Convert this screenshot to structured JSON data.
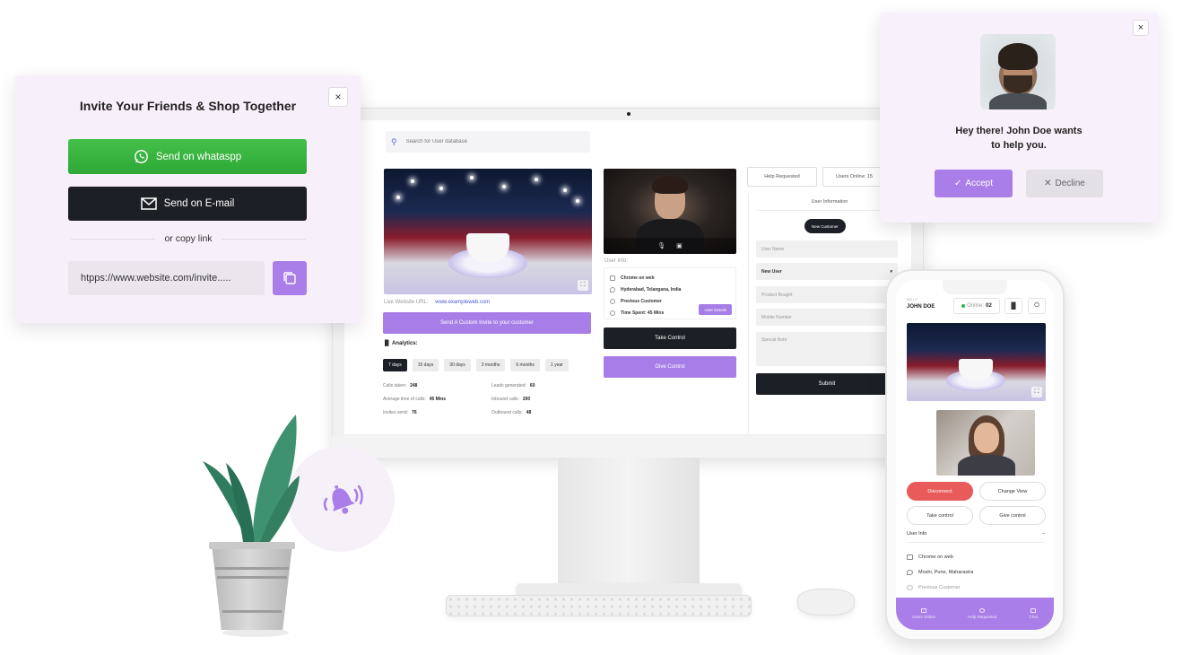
{
  "invite_panel": {
    "title": "Invite Your Friends & Shop Together",
    "close_label": "×",
    "whatsapp_label": "Send on whataspp",
    "email_label": "Send on E-mail",
    "divider_text": "or copy link",
    "link_value": "htpps://www.website.com/invite....."
  },
  "help_popup": {
    "close_label": "×",
    "message_line1": "Hey there! John Doe wants",
    "message_line2": "to help you.",
    "accept_label": "Accept",
    "decline_label": "Decline"
  },
  "desktop": {
    "search_placeholder": "Search for User database",
    "live_url_label": "Live Website URL:",
    "live_url_value": "www.exampleweb.com",
    "send_invite_label": "Send A Custom Invite to your customer",
    "analytics_title": "Analytics:",
    "ranges": [
      "7 days",
      "15 days",
      "30 days",
      "3 months",
      "6 months",
      "1 year"
    ],
    "active_range": "7 days",
    "stats": [
      {
        "label": "Calls taken:",
        "value": "248"
      },
      {
        "label": "Average time of calls:",
        "value": "45 Mins"
      },
      {
        "label": "Invites send:",
        "value": "76"
      },
      {
        "label": "Leads generated:",
        "value": "60"
      },
      {
        "label": "Inbound calls:",
        "value": "200"
      },
      {
        "label": "Outbound calls:",
        "value": "48"
      }
    ],
    "user_info_label": "User Info:",
    "user_info": {
      "browser": "Chrome on web",
      "location": "Hyderabad, Telangana, India",
      "status": "Previous Customer",
      "time_spent": "Time Spent: 45 Mins"
    },
    "user_details_label": "User Details",
    "take_control_label": "Take Control",
    "give_control_label": "Give Control",
    "help_requested_label": "Help Requested",
    "users_online_label": "Users Online: 15",
    "form_title": "User Information",
    "new_customer_label": "New Customer",
    "user_name_placeholder": "User Name",
    "new_user_value": "New User",
    "product_bought_placeholder": "Product Bought",
    "mobile_number_placeholder": "Mobile Number",
    "special_note_placeholder": "Special Note",
    "submit_label": "Submit"
  },
  "phone": {
    "hello_label": "HELLO",
    "user_name": "JOHN DOE",
    "online_label": "Online:",
    "online_count": "02",
    "disconnect_label": "Disconnect",
    "change_view_label": "Change View",
    "take_control_label": "Take control",
    "give_control_label": "Give control",
    "user_info_label": "User Info",
    "collapse_label": "–",
    "browser": "Chrome on web",
    "location": "Moshi, Pune, Maharastra",
    "status": "Previous Customer",
    "nav": [
      "Users Online",
      "Help Requested",
      "Chat"
    ]
  },
  "colors": {
    "accent": "#a97ee8",
    "dark": "#1d1f26",
    "whatsapp": "#34b03c",
    "danger": "#e95b5b",
    "panel_bg": "#f7eff9"
  }
}
